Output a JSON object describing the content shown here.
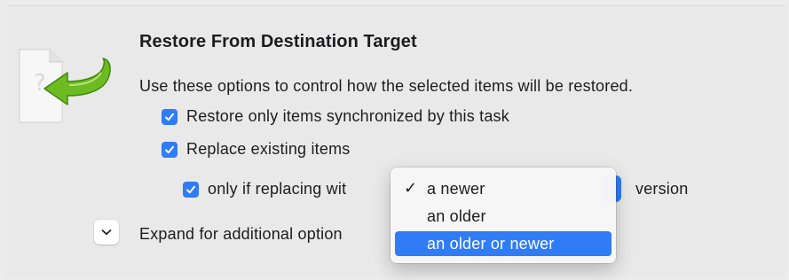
{
  "section": {
    "title": "Restore From Destination Target",
    "description": "Use these options to control how the selected items will be restored."
  },
  "options": {
    "restore_only": {
      "label": "Restore only items synchronized by this task",
      "checked": true
    },
    "replace_existing": {
      "label": "Replace existing items",
      "checked": true
    },
    "only_if_replacing": {
      "label": "only if replacing wit",
      "checked": true,
      "trailing_label": "version"
    }
  },
  "popup_menu": {
    "items": [
      {
        "label": "a newer",
        "checked": true,
        "highlighted": false
      },
      {
        "label": "an older",
        "checked": false,
        "highlighted": false
      },
      {
        "label": "an older or newer",
        "checked": false,
        "highlighted": true
      }
    ],
    "checkmark": "✓"
  },
  "expand": {
    "label": "Expand for additional option"
  },
  "colors": {
    "accent": "#2f7cf6",
    "background": "#ececec",
    "icon_arrow": "#5fae1a"
  },
  "icons": {
    "document": "restore-document-icon",
    "arrow": "green-return-arrow-icon",
    "disclosure": "chevron-down-icon",
    "checkbox": "checkmark-icon"
  }
}
